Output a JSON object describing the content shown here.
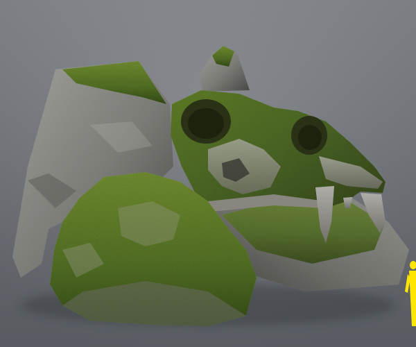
{
  "scene": {
    "subject": "moss-covered-rocks-with-skull",
    "colors": {
      "background_top": "#84878c",
      "background_bottom": "#5f6369",
      "rock_light": "#a7a7a2",
      "rock_mid": "#7f807b",
      "rock_dark": "#4a4b47",
      "moss_light": "#7e9a3a",
      "moss_mid": "#5d7a29",
      "moss_dark": "#3c5219",
      "scale_figure": "#ffe600"
    }
  }
}
